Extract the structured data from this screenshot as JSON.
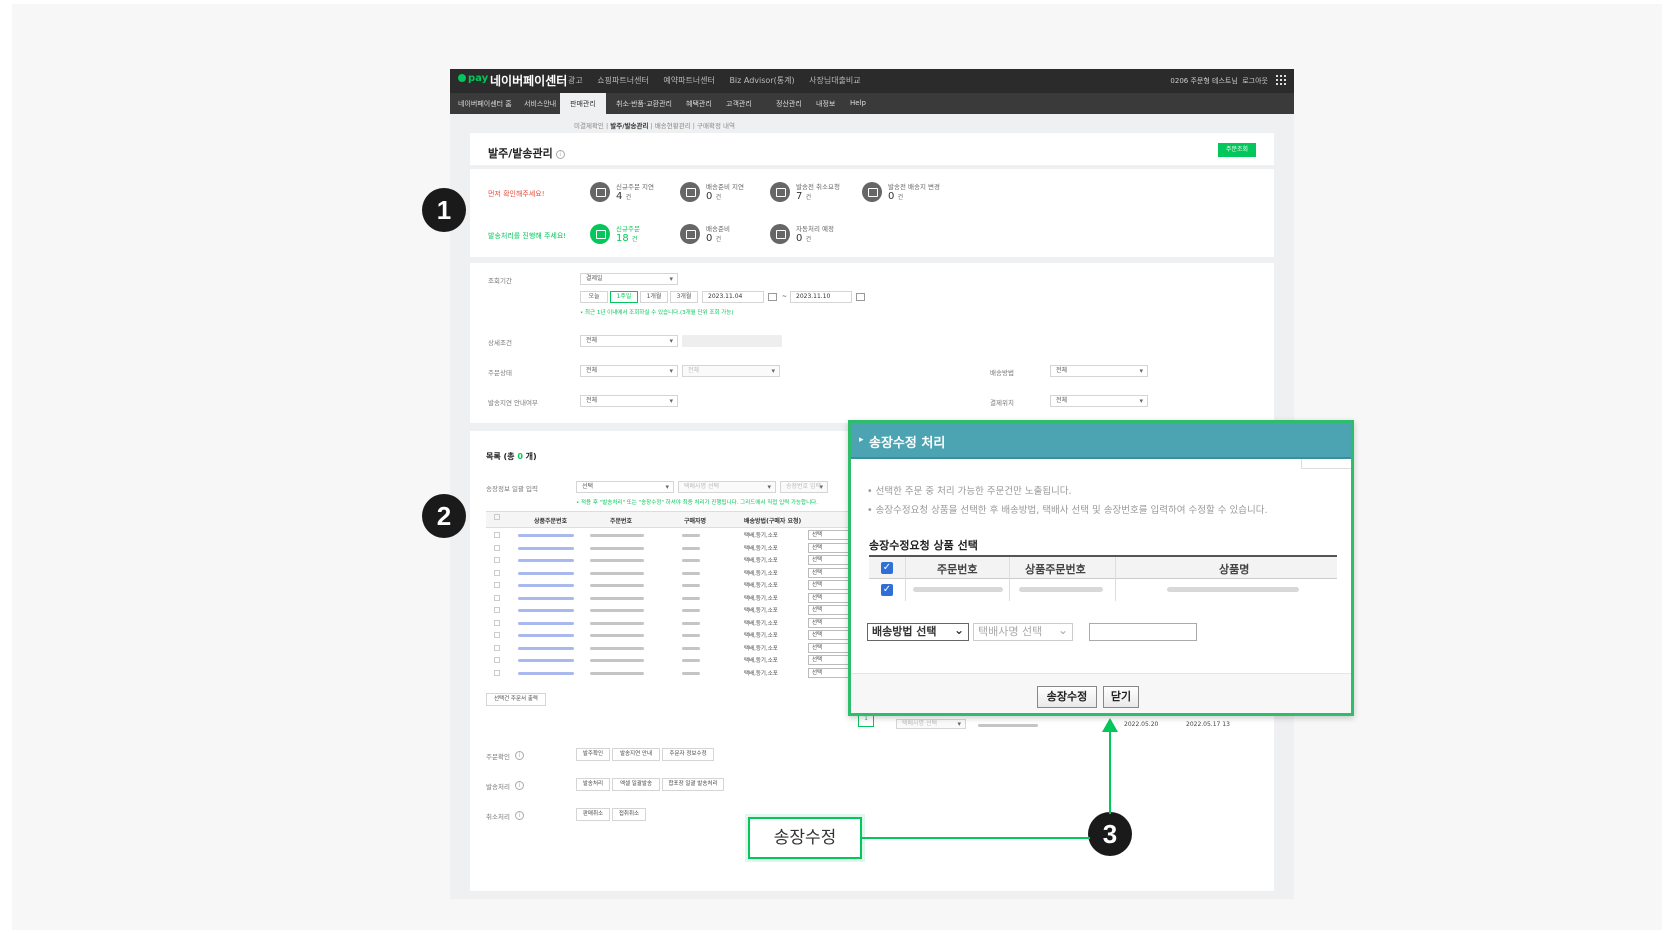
{
  "header": {
    "logo": "pay",
    "brand": "네이버페이센터",
    "nav": [
      "광고",
      "쇼핑파트너센터",
      "예약파트너센터",
      "Biz Advisor(통계)",
      "사장님대출비교"
    ],
    "user": "0206 주문형 테스트님",
    "logout": "로그아웃"
  },
  "subnav": [
    "네이버페이센터 홈",
    "서비스안내",
    "판매관리",
    "취소·반품·교환관리",
    "혜택관리",
    "고객관리",
    "정산관리",
    "내정보",
    "Help"
  ],
  "thirdnav": [
    "미결제확인",
    "발주/발송관리",
    "배송현황관리",
    "구매확정 내역"
  ],
  "page": {
    "title": "발주/발송관리",
    "order_button": "주문조회"
  },
  "status": {
    "row1_label": "먼저 확인해주세요!",
    "row2_label": "발송처리를 진행해 주세요!",
    "stats_row1": [
      {
        "title": "신규주문 지연",
        "count": "4",
        "unit": "건"
      },
      {
        "title": "배송준비 지연",
        "count": "0",
        "unit": "건"
      },
      {
        "title": "발송전 취소요청",
        "count": "7",
        "unit": "건"
      },
      {
        "title": "발송전 배송지 변경",
        "count": "0",
        "unit": "건"
      }
    ],
    "stats_row2": [
      {
        "title": "신규주문",
        "count": "18",
        "unit": "건"
      },
      {
        "title": "배송준비",
        "count": "0",
        "unit": "건"
      },
      {
        "title": "자동처리 예정",
        "count": "0",
        "unit": "건"
      }
    ]
  },
  "search": {
    "period_label": "조회기간",
    "period_select": "결제일",
    "period_buttons": [
      "오늘",
      "1주일",
      "1개월",
      "3개월"
    ],
    "date_from": "2023.11.04",
    "date_sep": "~",
    "date_to": "2023.11.10",
    "period_note": "• 최근 1년 이내에서 조회하실 수 있습니다.(3개월 단위 조회 가능)",
    "detail_label": "상세조건",
    "detail_select": "전체",
    "order_status_label": "주문상태",
    "order_status_select": "전체",
    "order_status_sub": "전체",
    "delivery_method_label": "배송방법",
    "delivery_method_select": "전체",
    "delay_label": "발송지연 안내여부",
    "delay_select": "전체",
    "payment_label": "결제위치",
    "payment_select": "전체"
  },
  "list": {
    "title_prefix": "목록 (총 ",
    "count": "0",
    "title_suffix": " 개)",
    "bulk_label": "송장정보 일괄 입력",
    "bulk_select": "선택",
    "courier_placeholder": "택배사명 선택",
    "invoice_placeholder": "송장번호 입력",
    "note": "• 적용 후 \"발송처리\" 또는 \"송장수정\" 하셔야 최종 처리가 진행됩니다. 그리드에서 직접 입력 가능합니다.",
    "columns": [
      "상품주문번호",
      "주문번호",
      "구매자명",
      "배송방법(구매자 요청)"
    ],
    "rows": [
      {
        "ship": "택배,등기,소포",
        "sel": "선택"
      },
      {
        "ship": "택배,등기,소포",
        "sel": "선택"
      },
      {
        "ship": "택배,등기,소포",
        "sel": "선택"
      },
      {
        "ship": "택배,등기,소포",
        "sel": "선택"
      },
      {
        "ship": "택배,등기,소포",
        "sel": "선택"
      },
      {
        "ship": "택배,등기,소포",
        "sel": "선택"
      },
      {
        "ship": "택배,등기,소포",
        "sel": "선택"
      },
      {
        "ship": "택배,등기,소포",
        "sel": "선택"
      },
      {
        "ship": "택배,등기,소포",
        "sel": "선택"
      },
      {
        "ship": "택배,등기,소포",
        "sel": "선택"
      },
      {
        "ship": "택배,등기,소포",
        "sel": "선택"
      },
      {
        "ship": "택배,등기,소포",
        "sel": "선택"
      }
    ],
    "last_row_courier": "택배사명 선택",
    "last_row_date1": "2022.05.20",
    "last_row_date2": "2022.05.17 13",
    "excel_button": "선택건 주문서 출력",
    "page": "1"
  },
  "actions": {
    "confirm_label": "주문확인",
    "confirm_buttons": [
      "발주확인",
      "발송지연 안내",
      "주문자 정보수정"
    ],
    "ship_label": "발송처리",
    "ship_buttons": [
      "발송처리",
      "엑셀 일괄발송",
      "합포장 일괄 발송처리"
    ],
    "cancel_label": "취소처리",
    "cancel_buttons": [
      "판매취소",
      "접취취소"
    ]
  },
  "popup": {
    "title": "송장수정 처리",
    "note1": "• 선택한 주문 중 처리 가능한 주문건만 노출됩니다.",
    "note2": "• 송장수정요청 상품을 선택한 후 배송방법, 택배사 선택 및 송장번호를 입력하여 수정할 수 있습니다.",
    "section_title": "송장수정요청 상품 선택",
    "columns": [
      "주문번호",
      "상품주문번호",
      "상품명"
    ],
    "delivery_select": "배송방법 선택",
    "courier_select": "택배사명 선택",
    "edit_button": "송장수정",
    "close_button": "닫기"
  },
  "annotations": {
    "marker1": "1",
    "marker2": "2",
    "marker3": "3",
    "callout": "송장수정"
  },
  "colors": {
    "accent": "#03c75a",
    "popup_header": "#4ca3b1",
    "topbar": "#2b2b2b"
  }
}
